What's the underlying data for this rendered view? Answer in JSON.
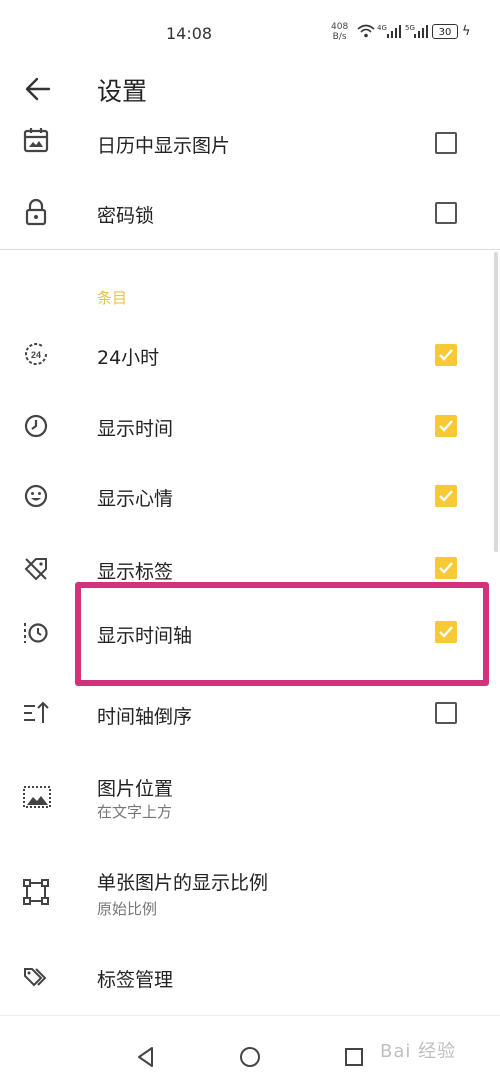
{
  "status": {
    "time": "14:08",
    "net_speed": "408",
    "net_unit": "B/s",
    "sim1": "4G",
    "sim2": "5G",
    "battery": "30"
  },
  "appbar": {
    "title": "设置"
  },
  "rows_top": [
    {
      "icon": "calendar-image-icon",
      "label": "日历中显示图片",
      "checked": false
    },
    {
      "icon": "lock-icon",
      "label": "密码锁",
      "checked": false
    }
  ],
  "section_entries": {
    "label": "条目"
  },
  "rows": [
    {
      "icon": "24-hour-icon",
      "label": "24小时",
      "checked": true
    },
    {
      "icon": "clock-icon",
      "label": "显示时间",
      "checked": true
    },
    {
      "icon": "smiley-icon",
      "label": "显示心情",
      "checked": true
    },
    {
      "icon": "tag-icon",
      "label": "显示标签",
      "checked": true
    },
    {
      "icon": "timeline-icon",
      "label": "显示时间轴",
      "checked": true
    },
    {
      "icon": "sort-reverse-icon",
      "label": "时间轴倒序",
      "checked": false
    }
  ],
  "image_position": {
    "label": "图片位置",
    "value": "在文字上方"
  },
  "image_ratio": {
    "label": "单张图片的显示比例",
    "value": "原始比例"
  },
  "tag_manage": {
    "label": "标签管理"
  },
  "watermark": "Bai 经验",
  "colors": {
    "accent": "#f7c934",
    "section": "#e8c340",
    "highlight": "#d3317a"
  }
}
